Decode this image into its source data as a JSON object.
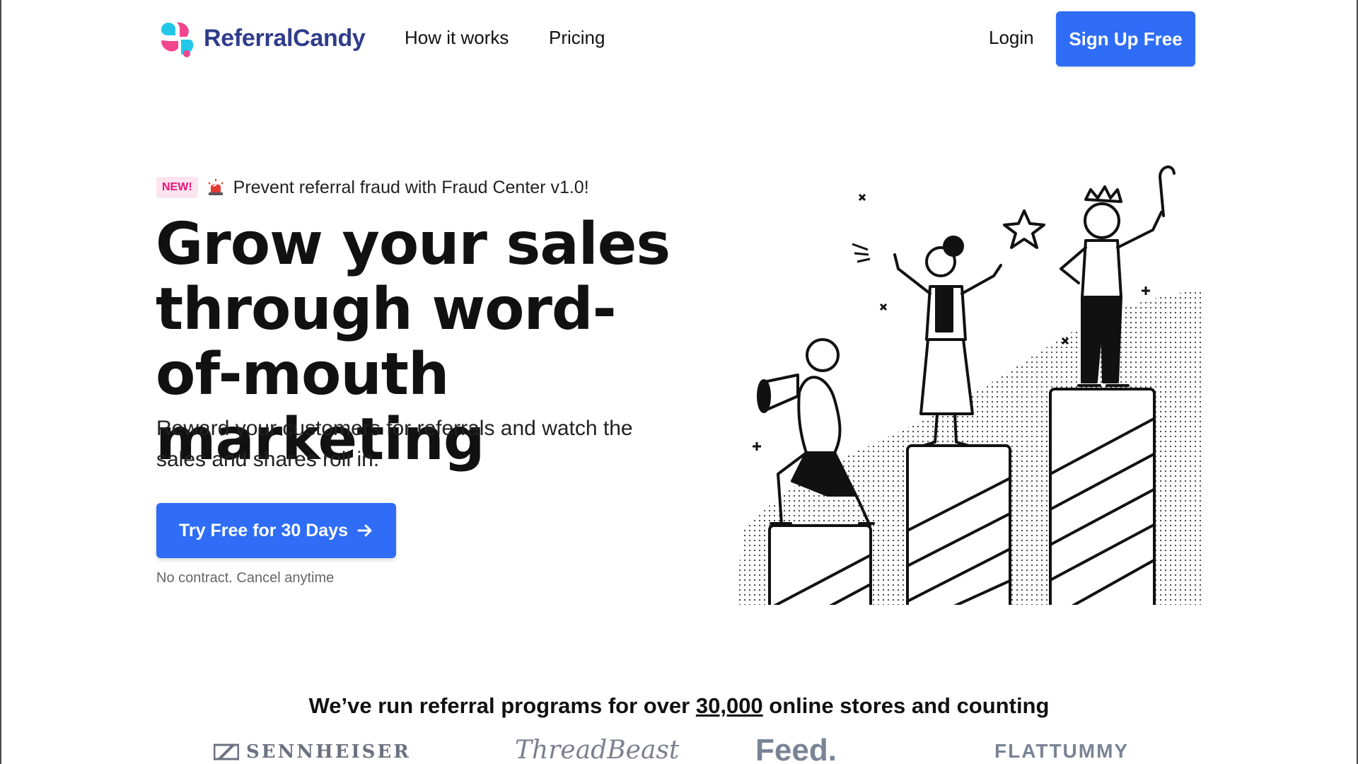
{
  "nav": {
    "logo_text": "ReferralCandy",
    "how_it_works": "How it works",
    "pricing": "Pricing",
    "login": "Login",
    "signup": "Sign Up Free"
  },
  "hero": {
    "badge": "NEW!",
    "badge_icon": "siren-icon",
    "announcement": "Prevent referral fraud with Fraud Center v1.0!",
    "headline": "Grow your sales through word-of-mouth marketing",
    "subhead": "Reward your customers for referrals and watch the sales and shares roll in.",
    "cta": "Try Free for 30 Days",
    "cta_icon": "arrow-right-icon",
    "note": "No contract. Cancel anytime"
  },
  "proof": {
    "text_before": "We’ve run referral programs for over ",
    "count": "30,000",
    "text_after": " online stores and counting",
    "brands": [
      "SENNHEISER",
      "ThreadBeast",
      "Feed.",
      "FLATTUMMY"
    ]
  },
  "colors": {
    "primary": "#2F6DF6",
    "logo_text": "#2F3C8C",
    "badge_bg": "#FCE4EF",
    "badge_text": "#E5157A",
    "brand_gray": "#6b7180"
  }
}
